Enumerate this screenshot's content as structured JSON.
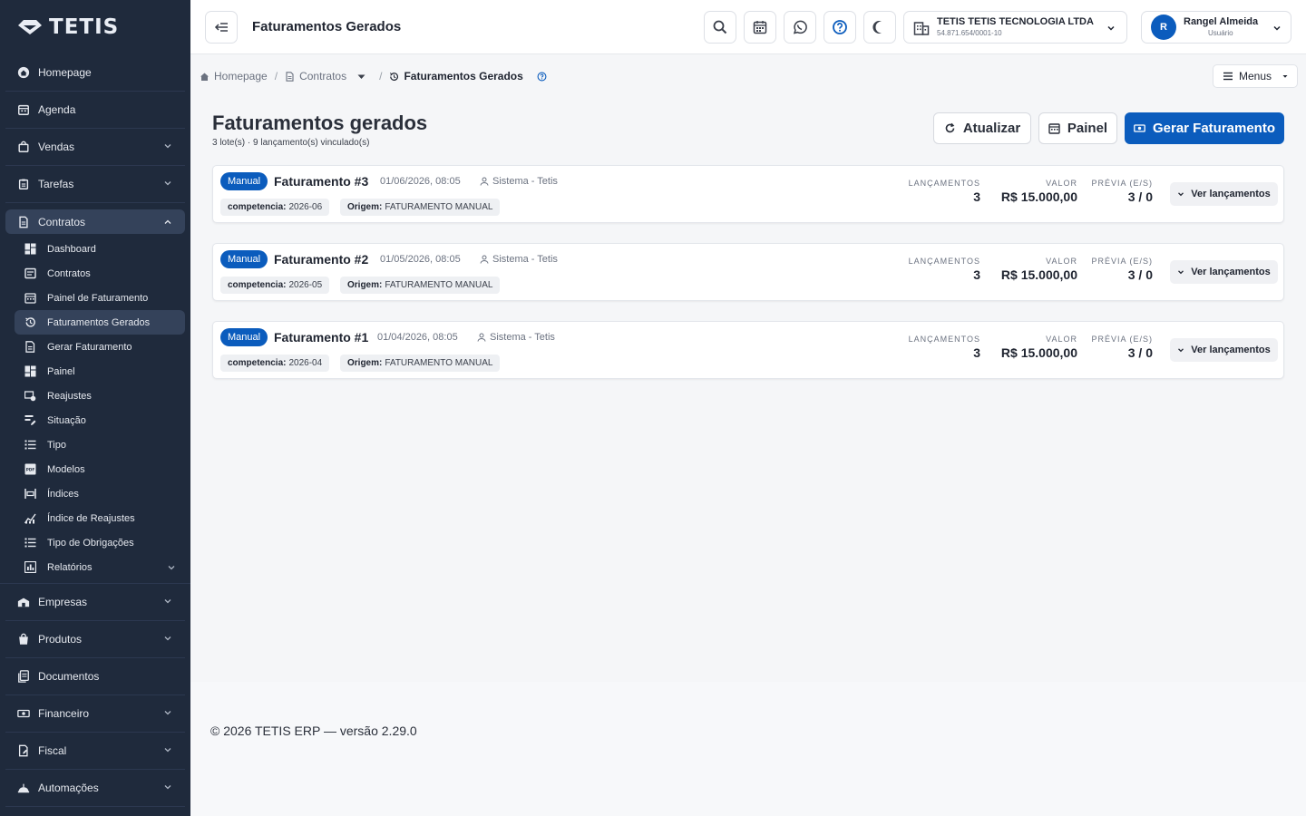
{
  "app": {
    "logo_text": "TETIS"
  },
  "sidebar": {
    "items_top": [
      {
        "label": "Homepage",
        "icon": "home-icon"
      },
      {
        "label": "Agenda",
        "icon": "calendar-icon"
      },
      {
        "label": "Vendas",
        "icon": "bag-icon",
        "has_children": true
      },
      {
        "label": "Tarefas",
        "icon": "clipboard-icon",
        "has_children": true
      }
    ],
    "contratos": {
      "label": "Contratos",
      "sub": [
        {
          "label": "Dashboard"
        },
        {
          "label": "Contratos"
        },
        {
          "label": "Painel de Faturamento"
        },
        {
          "label": "Faturamentos Gerados",
          "active": true
        },
        {
          "label": "Gerar Faturamento"
        },
        {
          "label": "Painel"
        },
        {
          "label": "Reajustes"
        },
        {
          "label": "Situação"
        },
        {
          "label": "Tipo"
        },
        {
          "label": "Modelos"
        },
        {
          "label": "Índices"
        },
        {
          "label": "Índice de Reajustes"
        },
        {
          "label": "Tipo de Obrigações"
        },
        {
          "label": "Relatórios",
          "has_children": true
        }
      ]
    },
    "items_bottom": [
      {
        "label": "Empresas",
        "has_children": true
      },
      {
        "label": "Produtos",
        "has_children": true
      },
      {
        "label": "Documentos",
        "has_children": false
      },
      {
        "label": "Financeiro",
        "has_children": true
      },
      {
        "label": "Fiscal",
        "has_children": true
      },
      {
        "label": "Automações",
        "has_children": true
      }
    ]
  },
  "header": {
    "title": "Faturamentos Gerados",
    "company_name": "TETIS TETIS TECNOLOGIA LTDA",
    "company_cnpj": "54.871.654/0001-10",
    "user_initial": "R",
    "user_name": "Rangel Almeida",
    "user_role": "Usuário"
  },
  "breadcrumb": {
    "home": "Homepage",
    "contratos": "Contratos",
    "current": "Faturamentos Gerados",
    "menus": "Menus"
  },
  "page": {
    "title": "Faturamentos gerados",
    "subtitle": "3 lote(s) · 9 lançamento(s) vinculado(s)",
    "btn_atualizar": "Atualizar",
    "btn_painel": "Painel",
    "btn_gerar": "Gerar Faturamento"
  },
  "labels": {
    "lancamentos": "LANÇAMENTOS",
    "valor": "VALOR",
    "previa": "PRÉVIA (E/S)",
    "ver": "Ver lançamentos",
    "competencia": "competencia:",
    "origem": "Origem:"
  },
  "faturamentos": [
    {
      "badge": "Manual",
      "title": "Faturamento #3",
      "date": "01/06/2026, 08:05",
      "author": "Sistema - Tetis",
      "competencia": "2026-06",
      "origem": "FATURAMENTO MANUAL",
      "lancamentos": "3",
      "valor": "R$ 15.000,00",
      "previa": "3 / 0"
    },
    {
      "badge": "Manual",
      "title": "Faturamento #2",
      "date": "01/05/2026, 08:05",
      "author": "Sistema - Tetis",
      "competencia": "2026-05",
      "origem": "FATURAMENTO MANUAL",
      "lancamentos": "3",
      "valor": "R$ 15.000,00",
      "previa": "3 / 0"
    },
    {
      "badge": "Manual",
      "title": "Faturamento #1",
      "date": "01/04/2026, 08:05",
      "author": "Sistema - Tetis",
      "competencia": "2026-04",
      "origem": "FATURAMENTO MANUAL",
      "lancamentos": "3",
      "valor": "R$ 15.000,00",
      "previa": "3 / 0"
    }
  ],
  "footer": {
    "text": "© 2026 TETIS ERP — versão 2.29.0"
  },
  "colors": {
    "primary": "#0b5cbd",
    "sidebar_bg": "#1f2a3c"
  }
}
